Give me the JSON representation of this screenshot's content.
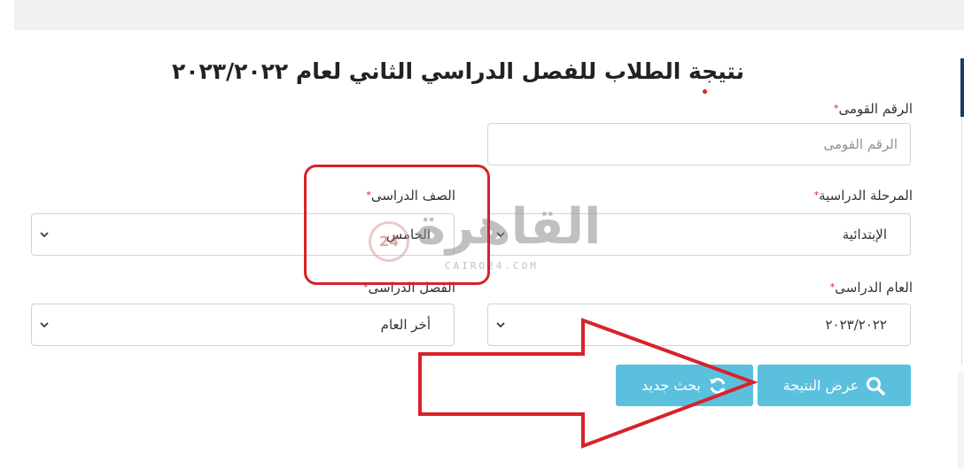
{
  "page": {
    "title": "نتيجة الطلاب للفصل الدراسي الثاني لعام ٢٠٢٣/٢٠٢٢"
  },
  "form": {
    "national_id": {
      "label": "الرقم القومى",
      "required_mark": "*",
      "placeholder": "الرقم القومى",
      "value": ""
    },
    "stage": {
      "label": "المرحلة الدراسية",
      "required_mark": "*",
      "value": "الإبتدائية"
    },
    "grade": {
      "label": "الصف الدراسى",
      "required_mark": "*",
      "value": "الخامس"
    },
    "academic_year": {
      "label": "العام الدراسى",
      "required_mark": "*",
      "value": "٢٠٢٣/٢٠٢٢"
    },
    "term": {
      "label": "الفصل الدراسى",
      "required_mark": "*",
      "value": "أخر العام"
    }
  },
  "buttons": {
    "show_result": "عرض النتيجة",
    "new_search": "بحث جديد"
  },
  "watermark": {
    "text": "القاهرة",
    "sub": "CAIRO24.COM",
    "badge": "24"
  },
  "colors": {
    "button": "#5bc0de",
    "annotation": "#d8222a",
    "required": "#d8222a"
  },
  "icons": {
    "show_result": "search-icon",
    "new_search": "refresh-icon",
    "select": "chevron-down-icon"
  }
}
